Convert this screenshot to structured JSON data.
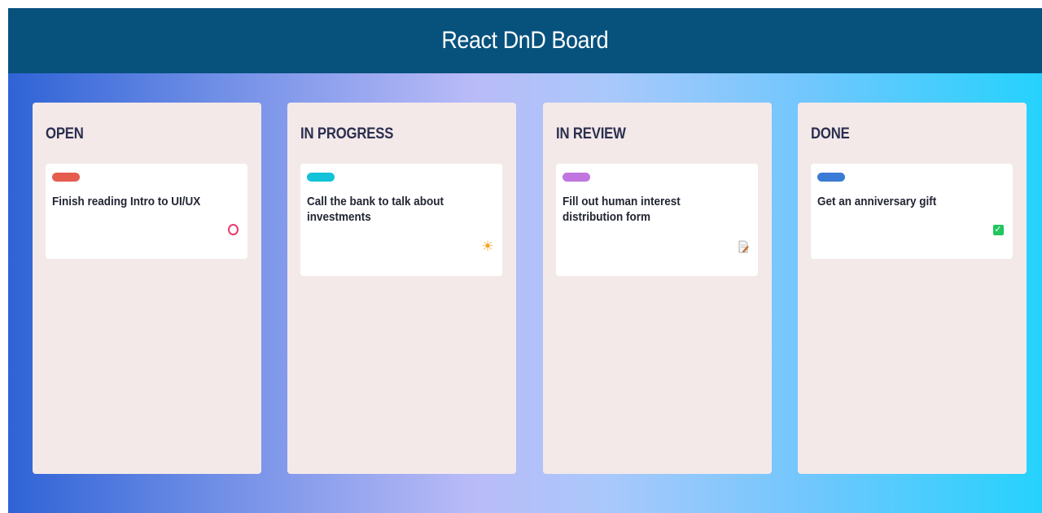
{
  "app": {
    "title": "React DnD Board"
  },
  "columns": [
    {
      "title": "OPEN",
      "card": {
        "title": "Finish reading Intro to UI/UX",
        "tag_color": "#e65c4f",
        "icon": "circle-o-icon"
      }
    },
    {
      "title": "IN PROGRESS",
      "card": {
        "title": "Call the bank to talk about investments",
        "tag_color": "#12c2d9",
        "icon": "sun-icon"
      }
    },
    {
      "title": "IN REVIEW",
      "card": {
        "title": "Fill out human interest distribution form",
        "tag_color": "#c075e0",
        "icon": "memo-icon"
      }
    },
    {
      "title": "DONE",
      "card": {
        "title": "Get an anniversary gift",
        "tag_color": "#3a7bd5",
        "icon": "check-icon"
      }
    }
  ],
  "colors": {
    "header_bg": "#07517d",
    "column_bg": "#f3e9e9",
    "gradient_start": "#2f63d6",
    "gradient_end": "#25d2fd"
  }
}
